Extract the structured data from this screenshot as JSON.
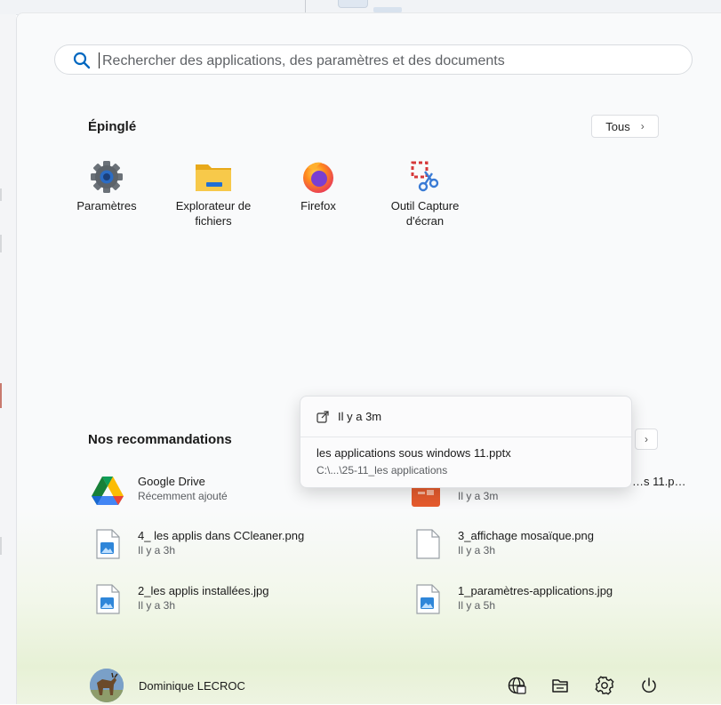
{
  "search": {
    "placeholder": "Rechercher des applications, des paramètres et des documents"
  },
  "pinned": {
    "title": "Épinglé",
    "all_label": "Tous",
    "apps": [
      {
        "label": "Paramètres",
        "icon": "settings-gear-icon"
      },
      {
        "label": "Explorateur de fichiers",
        "icon": "file-explorer-folder-icon"
      },
      {
        "label": "Firefox",
        "icon": "firefox-icon"
      },
      {
        "label": "Outil Capture d'écran",
        "icon": "snipping-tool-icon"
      }
    ]
  },
  "recommended": {
    "title": "Nos recommandations",
    "items": [
      {
        "name": "Google Drive",
        "time": "Récemment ajouté",
        "icon": "google-drive-icon"
      },
      {
        "name": "…s 11.p…",
        "time": "Il y a 3m",
        "icon": "powerpoint-icon"
      },
      {
        "name": "4_ les applis dans CCleaner.png",
        "time": "Il y a 3h",
        "icon": "image-file-icon"
      },
      {
        "name": "3_affichage mosaïque.png",
        "time": "Il y a 3h",
        "icon": "blank-file-icon"
      },
      {
        "name": "2_les applis installées.jpg",
        "time": "Il y a 3h",
        "icon": "image-file-icon"
      },
      {
        "name": "1_paramètres-applications.jpg",
        "time": "Il y a 5h",
        "icon": "image-file-icon"
      }
    ]
  },
  "tooltip": {
    "time": "Il y a 3m",
    "filename": "les applications sous windows 11.pptx",
    "path": "C:\\...\\25-11_les applications"
  },
  "footer": {
    "user_name": "Dominique LECROC",
    "icons": [
      "network-globe-icon",
      "documents-folder-icon",
      "settings-gear-icon",
      "power-icon"
    ]
  },
  "colors": {
    "accent": "#0067c0",
    "folder": "#f7c23c",
    "powerpoint": "#e55b2d",
    "gradient_bottom": "#e7f1d6"
  }
}
